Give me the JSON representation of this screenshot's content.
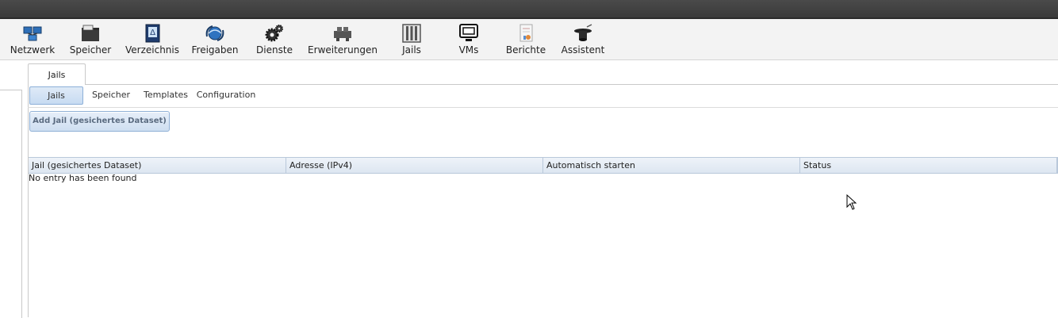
{
  "toolbar": {
    "items": [
      {
        "label": "Netzwerk",
        "icon": "network-icon"
      },
      {
        "label": "Speicher",
        "icon": "folder-icon"
      },
      {
        "label": "Verzeichnis",
        "icon": "directory-book-icon"
      },
      {
        "label": "Freigaben",
        "icon": "sharing-globe-icon"
      },
      {
        "label": "Dienste",
        "icon": "gears-icon"
      },
      {
        "label": "Erweiterungen",
        "icon": "plugins-icon"
      },
      {
        "label": "Jails",
        "icon": "jail-bars-icon"
      },
      {
        "label": "VMs",
        "icon": "monitor-icon"
      },
      {
        "label": "Berichte",
        "icon": "report-icon"
      },
      {
        "label": "Assistent",
        "icon": "wizard-hat-icon"
      }
    ]
  },
  "main_tab": {
    "label": "Jails"
  },
  "subtabs": {
    "items": [
      {
        "label": "Jails",
        "active": true
      },
      {
        "label": "Speicher",
        "active": false
      },
      {
        "label": "Templates",
        "active": false
      },
      {
        "label": "Configuration",
        "active": false
      }
    ]
  },
  "actions": {
    "add_label": "Add Jail (gesichertes Dataset)"
  },
  "table": {
    "columns": [
      "Jail (gesichertes Dataset)",
      "Adresse (IPv4)",
      "Automatisch starten",
      "Status"
    ],
    "empty_text": "No entry has been found"
  },
  "colors": {
    "titlebar": "#3f3f3f",
    "toolbar_bg": "#f3f3f3",
    "accent_border": "#8db0d8",
    "header_bg": "#dde6f1"
  }
}
